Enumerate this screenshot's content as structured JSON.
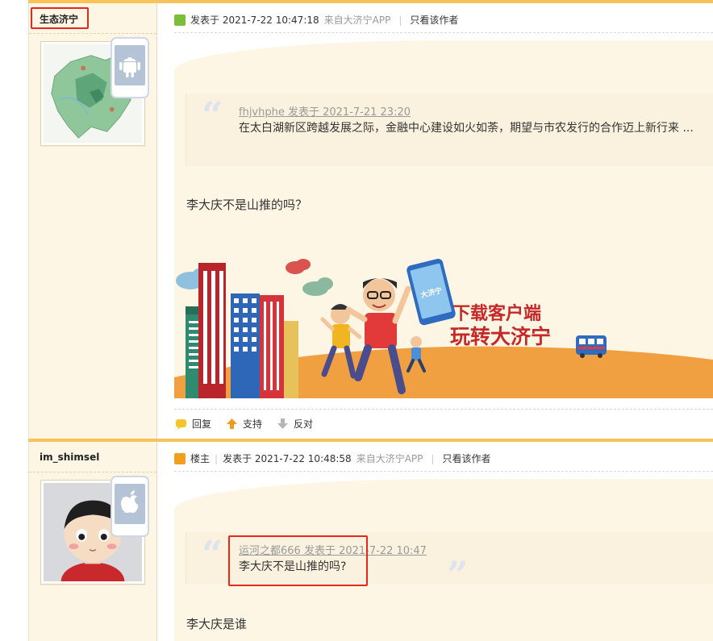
{
  "post1": {
    "username": "生态济宁",
    "device": "android-icon",
    "meta": {
      "posted": "发表于 2021-7-22 10:47:18",
      "app": "来自大济宁APP",
      "sep": "|",
      "only_author": "只看该作者"
    },
    "quote": {
      "author_line": "fhjvhphe 发表于 2021-7-21 23:20",
      "text": "在太白湖新区跨越发展之际，金融中心建设如火如荼，期望与市农发行的合作迈上新行来 ..."
    },
    "body": "李大庆不是山推的吗？",
    "banner": {
      "line1": "下载客户端",
      "line2": "玩转大济宁",
      "phone_text": "大济宁"
    },
    "actions": {
      "reply": "回复",
      "support": "支持",
      "oppose": "反对"
    }
  },
  "post2": {
    "username": "im_shimsel",
    "device": "apple-icon",
    "meta": {
      "host": "楼主",
      "sep1": "|",
      "posted": "发表于 2021-7-22 10:48:58",
      "app": "来自大济宁APP",
      "sep2": "|",
      "only_author": "只看该作者"
    },
    "quote": {
      "author_line": "运河之都666 发表于 2021-7-22 10:47",
      "text": "李大庆不是山推的吗?"
    },
    "body": "李大庆是谁"
  },
  "colors": {
    "highlight": "#e4291c",
    "topbar": "#f7c35a",
    "sidebar": "#fdf6e5"
  }
}
